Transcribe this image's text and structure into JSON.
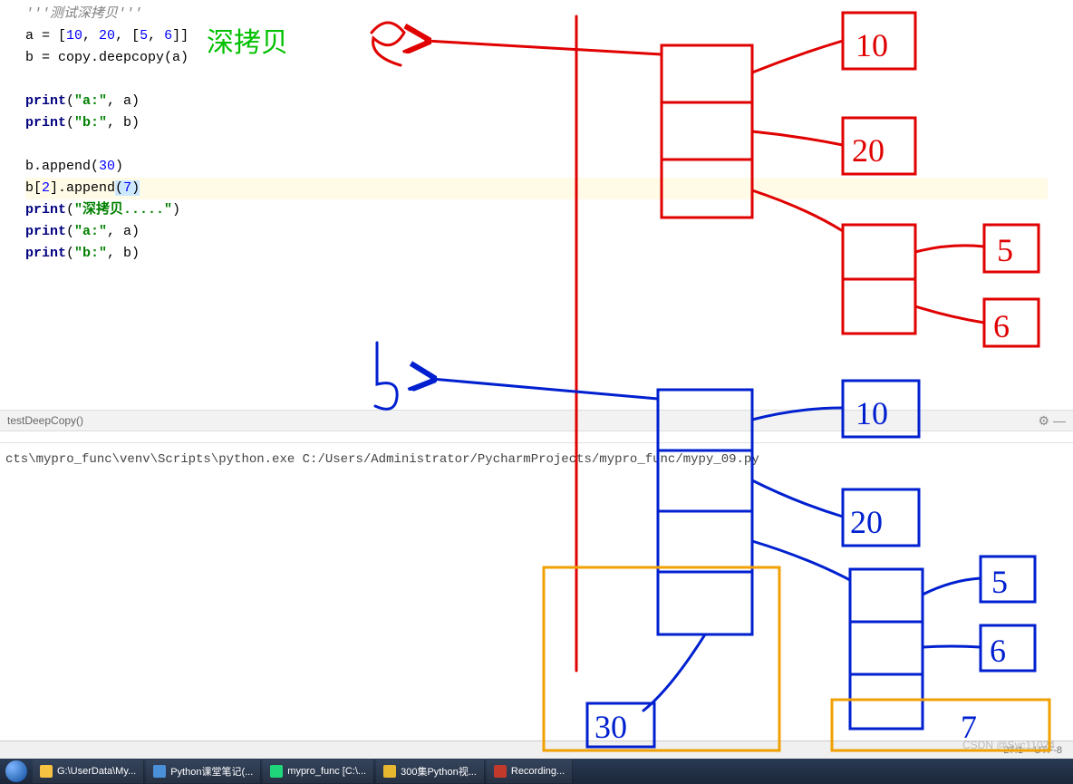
{
  "code": {
    "l1": "'''测试深拷贝'''",
    "l2_a": "a = [",
    "l2_b": "10",
    "l2_c": ", ",
    "l2_d": "20",
    "l2_e": ", [",
    "l2_f": "5",
    "l2_g": ", ",
    "l2_h": "6",
    "l2_i": "]]",
    "l3_a": "b = copy.deepcopy(a)",
    "l4_a": "print",
    "l4_b": "(",
    "l4_c": "\"a:\"",
    "l4_d": ", a)",
    "l5_a": "print",
    "l5_b": "(",
    "l5_c": "\"b:\"",
    "l5_d": ", b)",
    "l6_a": "b.append(",
    "l6_b": "30",
    "l6_c": ")",
    "l7_a": "b[",
    "l7_b": "2",
    "l7_c": "].append",
    "l7_d": "(",
    "l7_e": "7",
    "l7_f": ")",
    "l8_a": "print",
    "l8_b": "(",
    "l8_c": "\"深拷贝.....\"",
    "l8_d": ")",
    "l9_a": "print",
    "l9_b": "(",
    "l9_c": "\"a:\"",
    "l9_d": ", a)",
    "l10_a": "print",
    "l10_b": "(",
    "l10_c": "\"b:\"",
    "l10_d": ", b)"
  },
  "green_label": "深拷贝",
  "breadcrumb": "testDeepCopy()",
  "console_line": "cts\\mypro_func\\venv\\Scripts\\python.exe C:/Users/Administrator/PycharmProjects/mypro_func/mypy_09.py",
  "status": {
    "encoding": "UTF-8",
    "pos": "27:1"
  },
  "taskbar": {
    "items": [
      "G:\\UserData\\My...",
      "Python课堂笔记(...",
      "mypro_func [C:\\...",
      "300集Python视...",
      "Recording..."
    ]
  },
  "watermark": "CSDN @Syc11024",
  "annotations": {
    "a_label": "a",
    "b_label": "b",
    "red_vals": [
      "10",
      "20",
      "5",
      "6"
    ],
    "blue_vals": [
      "10",
      "20",
      "5",
      "6",
      "30",
      "7"
    ]
  }
}
